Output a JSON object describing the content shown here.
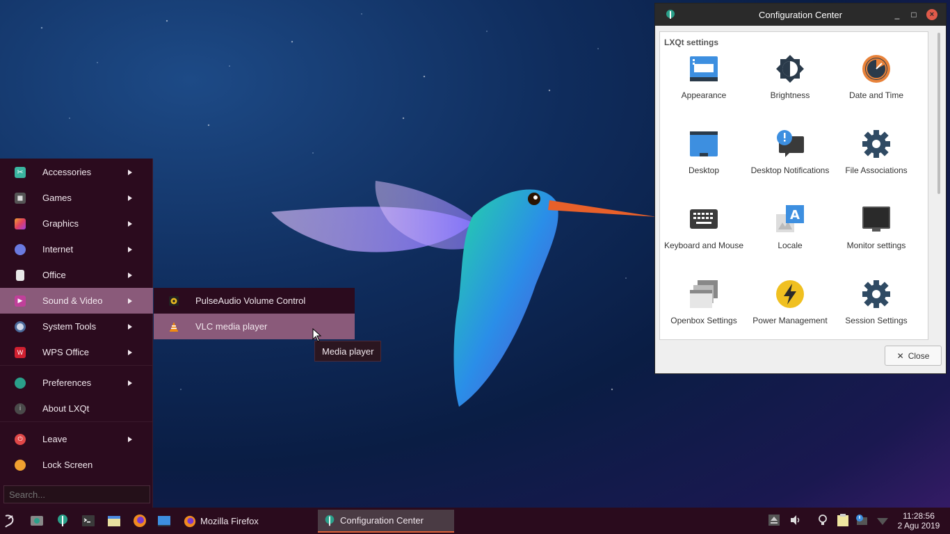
{
  "start_menu": {
    "items": [
      {
        "label": "Accessories",
        "icon": "accessories-icon",
        "has_submenu": true
      },
      {
        "label": "Games",
        "icon": "gamepad-icon",
        "has_submenu": true
      },
      {
        "label": "Graphics",
        "icon": "graphics-icon",
        "has_submenu": true
      },
      {
        "label": "Internet",
        "icon": "globe-icon",
        "has_submenu": true
      },
      {
        "label": "Office",
        "icon": "document-icon",
        "has_submenu": true
      },
      {
        "label": "Sound & Video",
        "icon": "multimedia-icon",
        "has_submenu": true,
        "active": true
      },
      {
        "label": "System Tools",
        "icon": "system-tools-icon",
        "has_submenu": true
      },
      {
        "label": "WPS Office",
        "icon": "wps-icon",
        "has_submenu": true
      },
      {
        "label": "Preferences",
        "icon": "lxqt-preferences-icon",
        "has_submenu": true
      },
      {
        "label": "About LXQt",
        "icon": "info-icon",
        "has_submenu": false
      },
      {
        "label": "Leave",
        "icon": "power-icon",
        "has_submenu": true
      },
      {
        "label": "Lock Screen",
        "icon": "lock-icon",
        "has_submenu": false
      }
    ],
    "search_placeholder": "Search..."
  },
  "submenu": {
    "items": [
      {
        "label": "PulseAudio Volume Control",
        "icon": "speaker-icon"
      },
      {
        "label": "VLC media player",
        "icon": "vlc-cone-icon",
        "active": true
      }
    ]
  },
  "tooltip": "Media player",
  "config_window": {
    "title": "Configuration Center",
    "group_title": "LXQt settings",
    "tiles": [
      {
        "label": "Appearance",
        "icon": "appearance-icon"
      },
      {
        "label": "Brightness",
        "icon": "brightness-icon"
      },
      {
        "label": "Date and Time",
        "icon": "clock-icon"
      },
      {
        "label": "Desktop",
        "icon": "desktop-icon"
      },
      {
        "label": "Desktop Notifications",
        "icon": "notification-icon"
      },
      {
        "label": "File Associations",
        "icon": "gear-icon"
      },
      {
        "label": "Keyboard and Mouse",
        "icon": "keyboard-icon"
      },
      {
        "label": "Locale",
        "icon": "locale-icon"
      },
      {
        "label": "Monitor settings",
        "icon": "monitor-icon"
      },
      {
        "label": "Openbox Settings",
        "icon": "openbox-icon"
      },
      {
        "label": "Power Management",
        "icon": "power-bolt-icon"
      },
      {
        "label": "Session Settings",
        "icon": "gear-icon"
      }
    ],
    "close_label": "Close"
  },
  "taskbar": {
    "tasks": [
      {
        "label": "Mozilla Firefox",
        "icon": "firefox-icon"
      },
      {
        "label": "Configuration Center",
        "icon": "lxqt-config-icon",
        "active": true
      }
    ],
    "clock_time": "11:28:56",
    "clock_date": "2 Agu 2019"
  },
  "colors": {
    "menu_bg": "#2b0b1e",
    "menu_highlight": "#8a5a7a",
    "taskbar_accent": "#e0633a",
    "titlebar_bg": "#2a2a2a"
  }
}
